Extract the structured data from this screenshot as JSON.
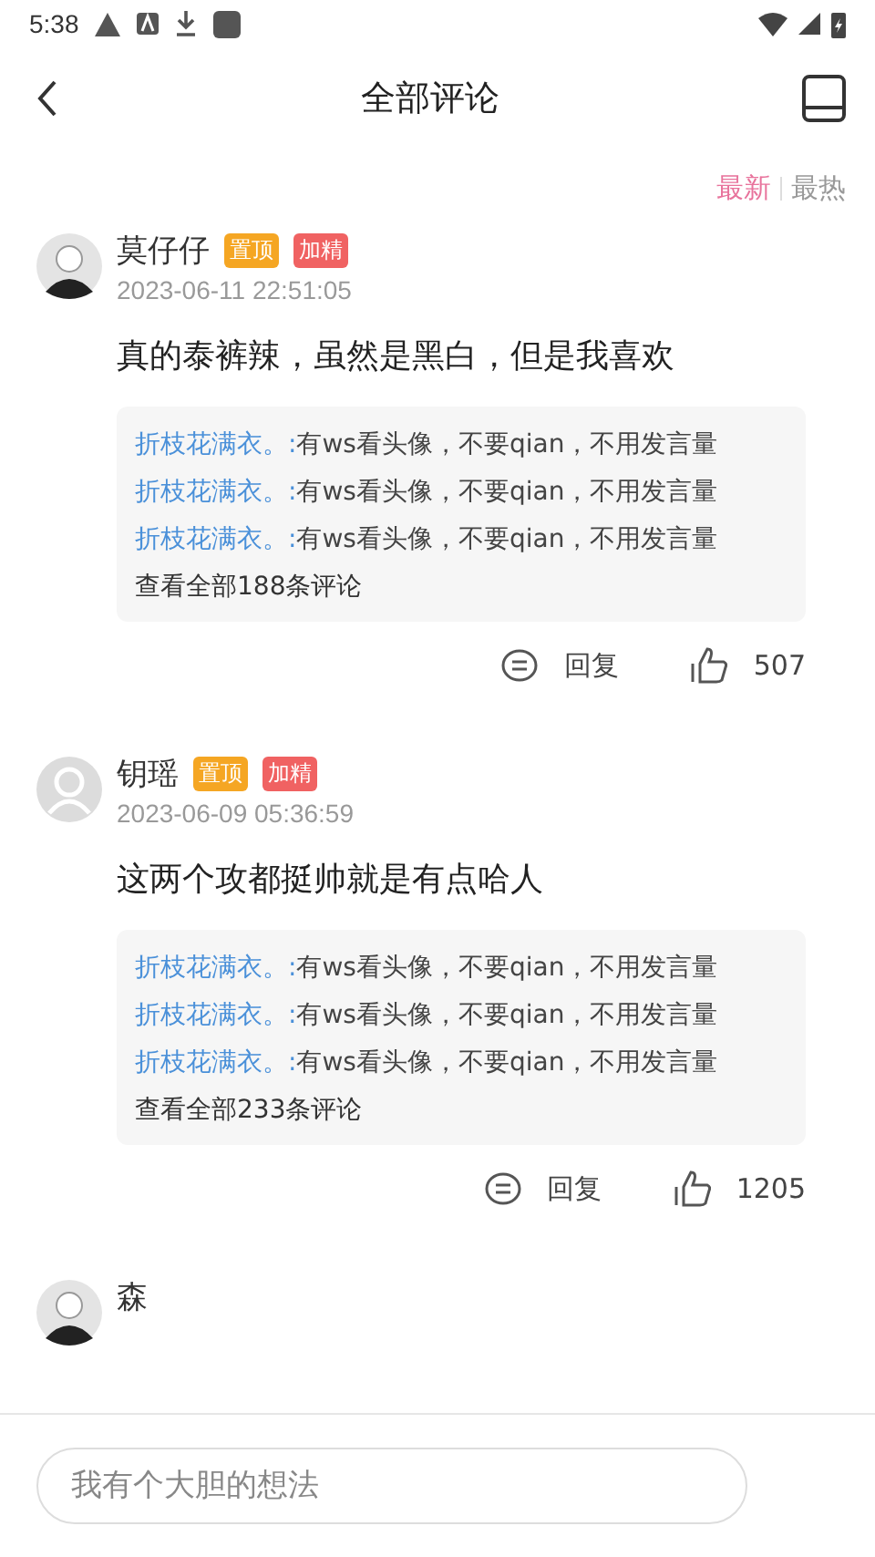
{
  "status_bar": {
    "time": "5:38"
  },
  "header": {
    "title": "全部评论"
  },
  "sort_tabs": [
    {
      "label": "最新",
      "selected": true
    },
    {
      "label": "最热",
      "selected": false
    }
  ],
  "comments": [
    {
      "avatar": {
        "kind": "image"
      },
      "name": "莫仔仔",
      "badges": [
        {
          "label": "置顶",
          "color": "#f5a623"
        },
        {
          "label": "加精",
          "color": "#f06262"
        }
      ],
      "date": "2023-06-11 22:51:05",
      "body": "真的泰裤辣，虽然是黑白，但是我喜欢",
      "replies": [
        {
          "author": "折枝花满衣。:",
          "text": "有ws看头像，不要qian，不用发言量"
        },
        {
          "author": "折枝花满衣。:",
          "text": "有ws看头像，不要qian，不用发言量"
        },
        {
          "author": "折枝花满衣。:",
          "text": "有ws看头像，不要qian，不用发言量"
        }
      ],
      "more": "查看全部188条评论",
      "reply_label": "回复",
      "likes": "507"
    },
    {
      "avatar": {
        "kind": "default"
      },
      "name": "钥瑶",
      "badges": [
        {
          "label": "置顶",
          "color": "#f5a623"
        },
        {
          "label": "加精",
          "color": "#f06262"
        }
      ],
      "date": "2023-06-09 05:36:59",
      "body": "这两个攻都挺帅就是有点哈人",
      "replies": [
        {
          "author": "折枝花满衣。:",
          "text": "有ws看头像，不要qian，不用发言量"
        },
        {
          "author": "折枝花满衣。:",
          "text": "有ws看头像，不要qian，不用发言量"
        },
        {
          "author": "折枝花满衣。:",
          "text": "有ws看头像，不要qian，不用发言量"
        }
      ],
      "more": "查看全部233条评论",
      "reply_label": "回复",
      "likes": "1205"
    },
    {
      "avatar": {
        "kind": "image"
      },
      "name": "森"
    }
  ],
  "input": {
    "placeholder": "我有个大胆的想法"
  }
}
